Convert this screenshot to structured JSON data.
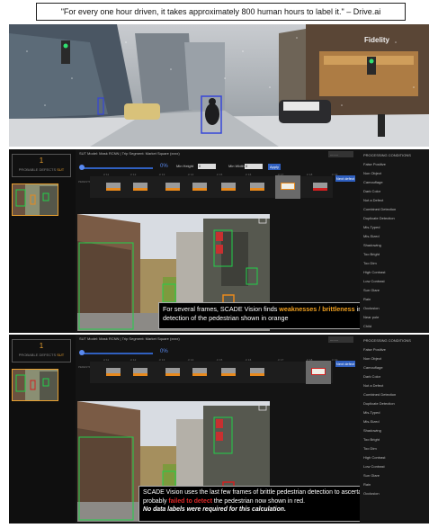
{
  "quote": {
    "text": "\"For every one hour driven, it takes approximately 800 human hours to label it.\" – Drive.ai"
  },
  "street_photo": {
    "sign_text": "Fidelity"
  },
  "panel1": {
    "defects": {
      "count": "1",
      "label_a": "PROBABLE DEFECTS",
      "label_b": "SUT"
    },
    "topbar": "SUT Model: Mask RCNN  |  Trip Segment: Market Square (xxxx)",
    "dropdown": "........",
    "progress_pct": "0%",
    "min_height_label": "Min Height",
    "min_height_value": "0",
    "min_width_label": "Min Width",
    "min_width_value": "0",
    "apply_label": "Apply",
    "next_label": "Next defect",
    "timeline_label": "PEDESTRIAN",
    "ticks": [
      "c/ 11",
      "c/ 12",
      "c/ 13",
      "c/ 14",
      "c/ 15",
      "c/ 16",
      "c/ 17",
      "c/ 18",
      "c/ 19"
    ],
    "conditions_title": "PROCESSING CONDITIONS",
    "conditions": [
      "False Positive",
      "Non Object",
      "Camouflage",
      "Dark Color",
      "Not a Defect",
      "Combined Detection",
      "Duplicate Detection",
      "Mis-Typed",
      "Mis-Sized",
      "Shadowing",
      "Too Bright",
      "Too Dim",
      "High Contrast",
      "Low Contrast",
      "Sun Glare",
      "Rain",
      "Occlusion",
      "Near pole",
      "Child"
    ],
    "caption": {
      "p1": "For several frames, SCADE Vision finds ",
      "highlight": "weaknesses / brittleness",
      "p2": " in the SUT’s detection of the pedestrian shown in orange"
    }
  },
  "panel2": {
    "defects": {
      "count": "1",
      "label_a": "PROBABLE DEFECTS",
      "label_b": "SUT"
    },
    "topbar": "SUT Model: Mask RCNN  |  Trip Segment: Market Square (xxxx)",
    "dropdown": "........",
    "progress_pct": "0%",
    "next_label": "Next defect",
    "timeline_label": "PEDESTRIAN",
    "ticks": [
      "c/ 11",
      "c/ 12",
      "c/ 13",
      "c/ 14",
      "c/ 15",
      "c/ 16",
      "c/ 17",
      "c/ 18",
      "c/ 19"
    ],
    "conditions_title": "PROCESSING CONDITIONS",
    "conditions": [
      "False Positive",
      "Non Object",
      "Camouflage",
      "Dark Color",
      "Not a Defect",
      "Combined Detection",
      "Duplicate Detection",
      "Mis-Typed",
      "Mis-Sized",
      "Shadowing",
      "Too Bright",
      "Too Dim",
      "High Contrast",
      "Low Contrast",
      "Sun Glare",
      "Rain",
      "Occlusion"
    ],
    "caption": {
      "p1": "SCADE Vision uses the last few frames of brittle pedestrian detection to ascertain that the SUT probably ",
      "highlight": "failed to detect",
      "p2": " the pedestrian now shown in red.",
      "p3": "No data labels were required for this calculation."
    }
  },
  "colors": {
    "accent_orange": "#e8891c",
    "highlight_red": "#e02828",
    "ui_blue": "#2f5fbf",
    "panel_bg": "#141414"
  }
}
